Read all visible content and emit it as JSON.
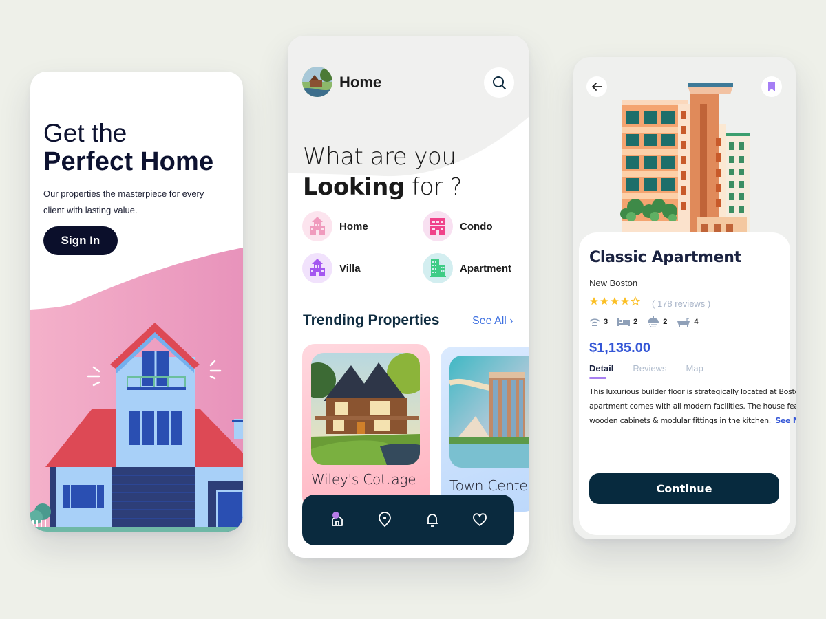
{
  "screen_welcome": {
    "title_line1": "Get the",
    "title_line2": "Perfect Home",
    "subtitle": "Our properties the masterpiece for every client with lasting value.",
    "signin_label": "Sign In"
  },
  "screen_home": {
    "header_title": "Home",
    "question_line1": "What are you",
    "question_bold": "Looking",
    "question_rest": " for ?",
    "categories": [
      {
        "label": "Home",
        "icon": "house-icon",
        "color": "#f09bbd",
        "bg": "#fce4ee"
      },
      {
        "label": "Condo",
        "icon": "condo-building-icon",
        "color": "#f0428a",
        "bg": "#f8e0f1"
      },
      {
        "label": "Villa",
        "icon": "villa-icon",
        "color": "#a457f0",
        "bg": "#f1e2fc"
      },
      {
        "label": "Apartment",
        "icon": "apartment-icon",
        "color": "#3fcc86",
        "bg": "#d3eef0"
      }
    ],
    "section_title": "Trending Properties",
    "see_all_label": "See All",
    "properties": [
      {
        "name": "Wiley's Cottage"
      },
      {
        "name": "Town Center"
      }
    ],
    "nav": [
      {
        "icon": "home-icon",
        "active": true
      },
      {
        "icon": "location-pin-icon",
        "active": false
      },
      {
        "icon": "bell-icon",
        "active": false
      },
      {
        "icon": "heart-icon",
        "active": false
      }
    ]
  },
  "screen_detail": {
    "title": "Classic Apartment",
    "location": "New Boston",
    "rating": 4,
    "rating_max": 5,
    "reviews": "( 178 reviews )",
    "features": [
      {
        "icon": "wifi-icon",
        "value": "3"
      },
      {
        "icon": "bed-icon",
        "value": "2"
      },
      {
        "icon": "shower-icon",
        "value": "2"
      },
      {
        "icon": "bathtub-icon",
        "value": "4"
      }
    ],
    "price": "$1,135.00",
    "tabs": [
      "Detail",
      "Reviews",
      "Map"
    ],
    "active_tab": "Detail",
    "description_lines": [
      "This luxurious builder floor is strategically located at Boston",
      "apartment comes with all modern facilities. The house features",
      "wooden cabinets & modular fittings in the kitchen."
    ],
    "see_more_label": "See More",
    "continue_label": "Continue"
  },
  "colors": {
    "background": "#eef0e9",
    "navy": "#0b0f2b",
    "dark_teal": "#0a2a3e",
    "accent_blue": "#3456d6",
    "star": "#fbbf24",
    "pink": "#f0a6c4"
  }
}
